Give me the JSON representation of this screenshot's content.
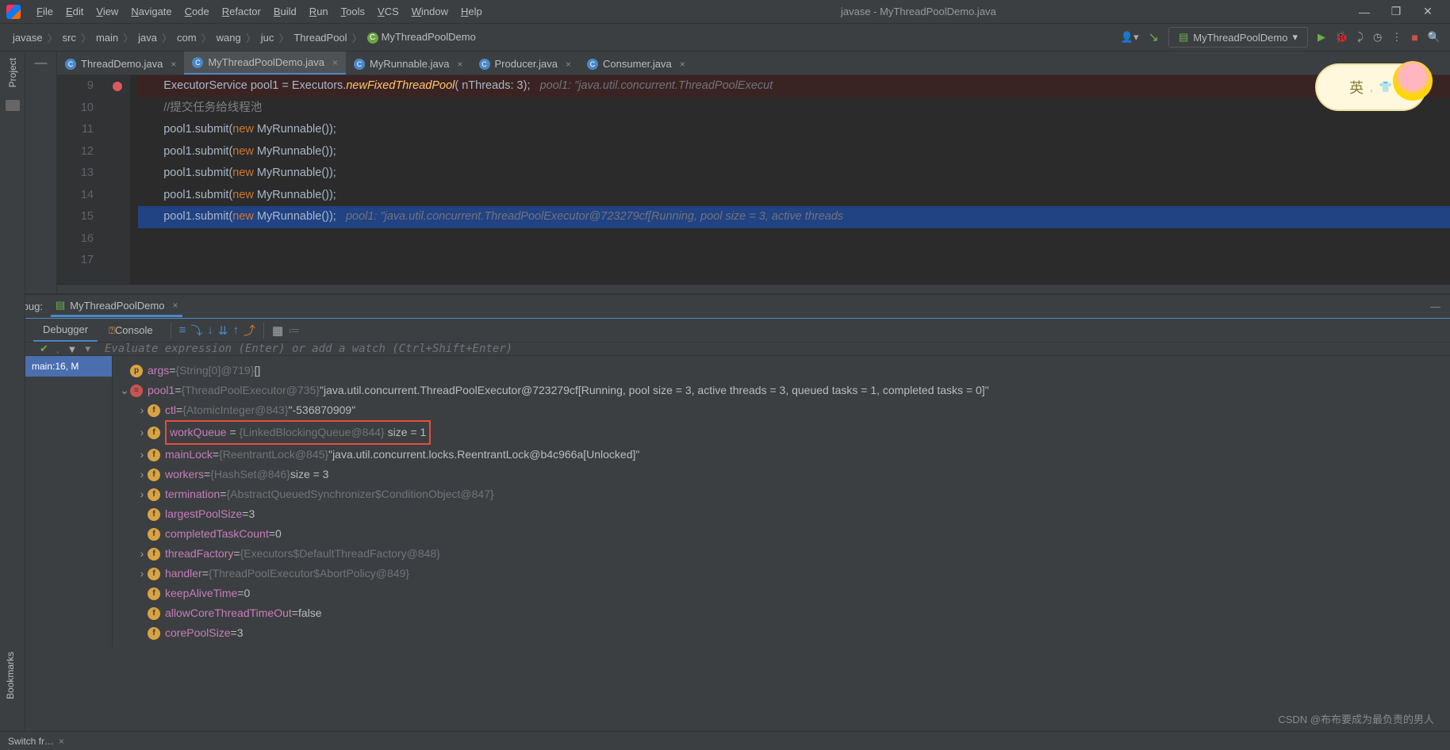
{
  "window": {
    "title": "javase - MyThreadPoolDemo.java"
  },
  "menu": [
    "File",
    "Edit",
    "View",
    "Navigate",
    "Code",
    "Refactor",
    "Build",
    "Run",
    "Tools",
    "VCS",
    "Window",
    "Help"
  ],
  "breadcrumbs": [
    "javase",
    "src",
    "main",
    "java",
    "com",
    "wang",
    "juc",
    "ThreadPool",
    "MyThreadPoolDemo"
  ],
  "run_config": "MyThreadPoolDemo",
  "tabs": [
    {
      "name": "ThreadDemo.java",
      "active": false
    },
    {
      "name": "MyThreadPoolDemo.java",
      "active": true
    },
    {
      "name": "MyRunnable.java",
      "active": false
    },
    {
      "name": "Producer.java",
      "active": false
    },
    {
      "name": "Consumer.java",
      "active": false
    }
  ],
  "code": {
    "lines": [
      {
        "n": 9,
        "bp": true,
        "bg": "bp",
        "html": "        ExecutorService pool1 = Executors.<i>newFixedThreadPool</i>( nThreads: 3);   <span class='hint'>pool1: \"java.util.concurrent.ThreadPoolExecut</span>"
      },
      {
        "n": 10,
        "html": ""
      },
      {
        "n": 11,
        "html": "        <span class='cmt'>//提交任务给线程池</span>"
      },
      {
        "n": 12,
        "html": "        pool1.submit(<span class='kw'>new</span> MyRunnable());"
      },
      {
        "n": 13,
        "html": "        pool1.submit(<span class='kw'>new</span> MyRunnable());"
      },
      {
        "n": 14,
        "html": "        pool1.submit(<span class='kw'>new</span> MyRunnable());"
      },
      {
        "n": 15,
        "html": "        pool1.submit(<span class='kw'>new</span> MyRunnable());"
      },
      {
        "n": 16,
        "bg": "sel",
        "html": "        pool1.submit(<span class='kw'>new</span> MyRunnable());   <span class='hint'>pool1: \"java.util.concurrent.ThreadPoolExecutor@723279cf[Running, pool size = 3, active threads </span>"
      },
      {
        "n": 17,
        "html": ""
      }
    ]
  },
  "debug": {
    "title": "Debug:",
    "session": "MyThreadPoolDemo",
    "tabs": [
      "Debugger",
      "Console"
    ],
    "eval_placeholder": "Evaluate expression (Enter) or add a watch (Ctrl+Shift+Enter)",
    "frame": "main:16, M",
    "vars": [
      {
        "indent": 0,
        "chev": "",
        "icon": "p",
        "name": "args",
        "eq": " = ",
        "type": "{String[0]@719}",
        "val": " []"
      },
      {
        "indent": 0,
        "chev": "v",
        "icon": "obj",
        "name": "pool1",
        "eq": " = ",
        "type": "{ThreadPoolExecutor@735}",
        "val": " \"java.util.concurrent.ThreadPoolExecutor@723279cf[Running, pool size = 3, active threads = 3, queued tasks = 1, completed tasks = 0]\""
      },
      {
        "indent": 1,
        "chev": ">",
        "icon": "f",
        "lock": true,
        "name": "ctl",
        "eq": " = ",
        "type": "{AtomicInteger@843}",
        "val": " \"-536870909\""
      },
      {
        "indent": 1,
        "chev": ">",
        "icon": "f",
        "lock": true,
        "name": "workQueue",
        "eq": " = ",
        "type": "{LinkedBlockingQueue@844}",
        "val": "  size = 1",
        "highlight": true
      },
      {
        "indent": 1,
        "chev": ">",
        "icon": "f",
        "lock": true,
        "name": "mainLock",
        "eq": " = ",
        "type": "{ReentrantLock@845}",
        "val": " \"java.util.concurrent.locks.ReentrantLock@b4c966a[Unlocked]\""
      },
      {
        "indent": 1,
        "chev": ">",
        "icon": "f",
        "lock": true,
        "name": "workers",
        "eq": " = ",
        "type": "{HashSet@846}",
        "val": "  size = 3"
      },
      {
        "indent": 1,
        "chev": ">",
        "icon": "f",
        "lock": true,
        "name": "termination",
        "eq": " = ",
        "type": "{AbstractQueuedSynchronizer$ConditionObject@847}",
        "val": ""
      },
      {
        "indent": 1,
        "chev": "",
        "icon": "f",
        "name": "largestPoolSize",
        "eq": " = ",
        "type": "",
        "val": "3"
      },
      {
        "indent": 1,
        "chev": "",
        "icon": "f",
        "name": "completedTaskCount",
        "eq": " = ",
        "type": "",
        "val": "0"
      },
      {
        "indent": 1,
        "chev": ">",
        "icon": "f",
        "lock": true,
        "name": "threadFactory",
        "eq": " = ",
        "type": "{Executors$DefaultThreadFactory@848}",
        "val": ""
      },
      {
        "indent": 1,
        "chev": ">",
        "icon": "f",
        "lock": true,
        "name": "handler",
        "eq": " = ",
        "type": "{ThreadPoolExecutor$AbortPolicy@849}",
        "val": ""
      },
      {
        "indent": 1,
        "chev": "",
        "icon": "f",
        "name": "keepAliveTime",
        "eq": " = ",
        "type": "",
        "val": "0"
      },
      {
        "indent": 1,
        "chev": "",
        "icon": "f",
        "name": "allowCoreThreadTimeOut",
        "eq": " = ",
        "type": "",
        "val": "false"
      },
      {
        "indent": 1,
        "chev": "",
        "icon": "f",
        "name": "corePoolSize",
        "eq": " = ",
        "type": "",
        "val": "3"
      }
    ]
  },
  "sidebar": {
    "project": "Project",
    "bookmarks": "Bookmarks"
  },
  "bottom": {
    "switch": "Switch fr…"
  },
  "watermark": "CSDN @布布要成为最负责的男人",
  "sticker": {
    "text": "英",
    "shirt": "👕"
  }
}
